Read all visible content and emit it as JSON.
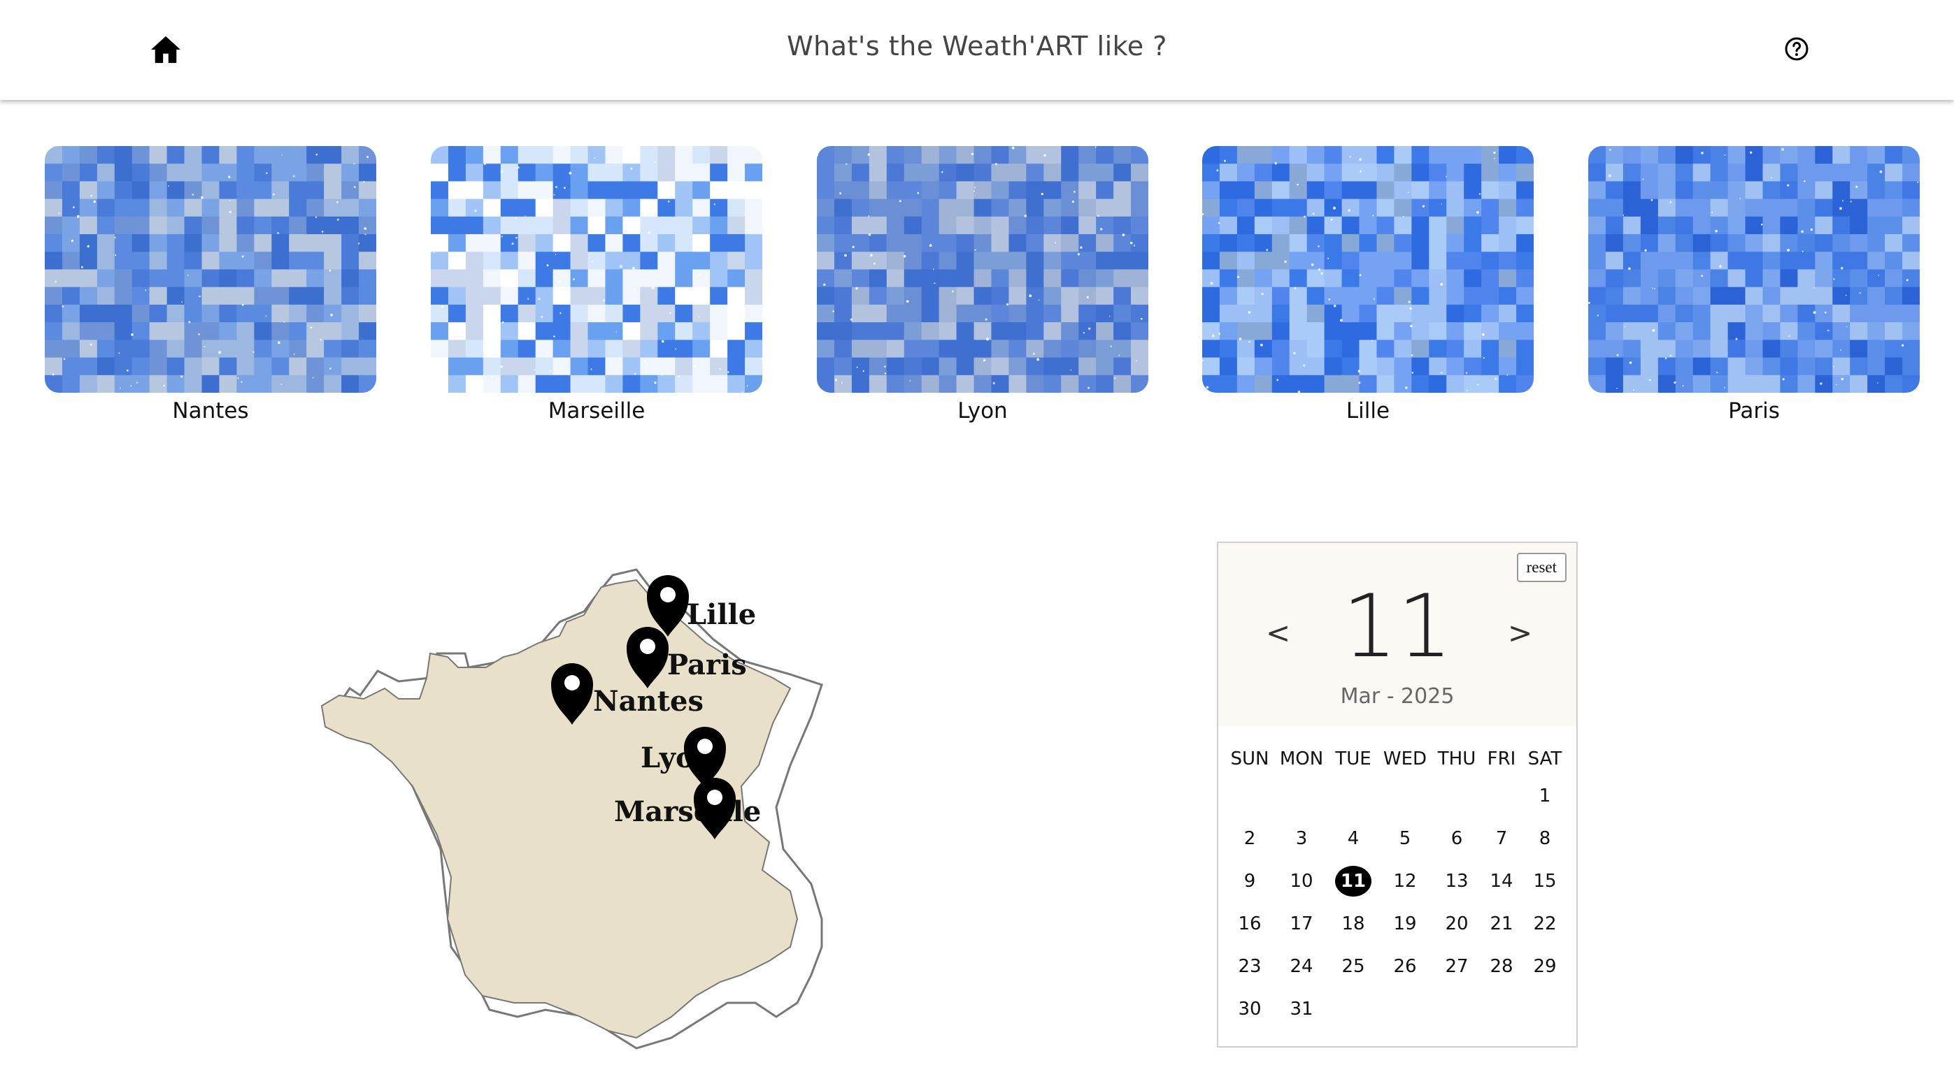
{
  "header": {
    "title": "What's the Weath'ART like ?",
    "home_icon": "home-icon",
    "help_icon": "help-circle-icon"
  },
  "tiles": [
    {
      "label": "Nantes"
    },
    {
      "label": "Marseille"
    },
    {
      "label": "Lyon"
    },
    {
      "label": "Lille"
    },
    {
      "label": "Paris"
    }
  ],
  "map": {
    "cities": [
      "Lille",
      "Paris",
      "Nantes",
      "Lyon",
      "Marseille"
    ],
    "land_color": "#e8e0c9",
    "border_color": "#777777"
  },
  "calendar": {
    "reset_label": "reset",
    "prev_label": "<",
    "next_label": ">",
    "day": "11",
    "month_year": "Mar - 2025",
    "weekdays": [
      "SUN",
      "MON",
      "TUE",
      "WED",
      "THU",
      "FRI",
      "SAT"
    ],
    "weeks": [
      [
        "",
        "",
        "",
        "",
        "",
        "",
        "1"
      ],
      [
        "2",
        "3",
        "4",
        "5",
        "6",
        "7",
        "8"
      ],
      [
        "9",
        "10",
        "11",
        "12",
        "13",
        "14",
        "15"
      ],
      [
        "16",
        "17",
        "18",
        "19",
        "20",
        "21",
        "22"
      ],
      [
        "23",
        "24",
        "25",
        "26",
        "27",
        "28",
        "29"
      ],
      [
        "30",
        "31",
        "",
        "",
        "",
        "",
        ""
      ]
    ],
    "selected": "11"
  }
}
